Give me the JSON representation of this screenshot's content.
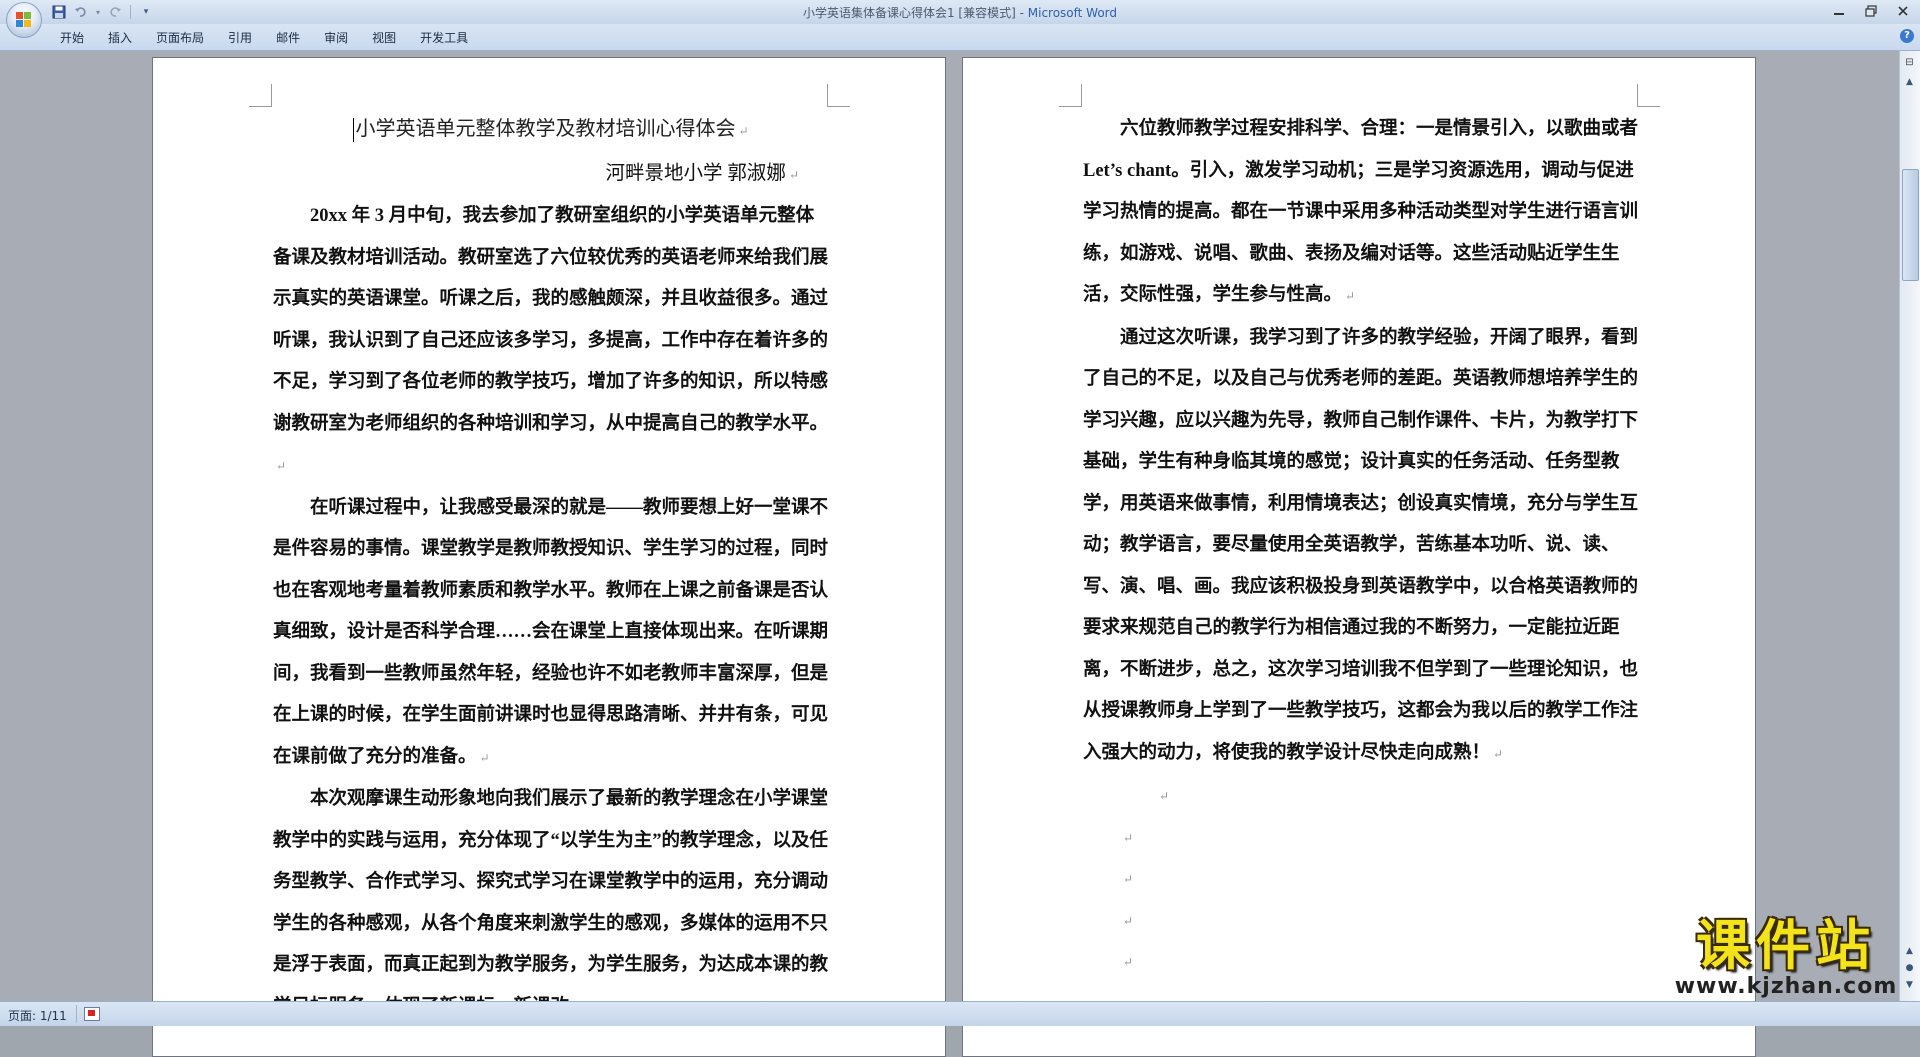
{
  "window": {
    "document_title": "小学英语集体备课心得体会1 [兼容模式] - ",
    "app_name": "Microsoft Word"
  },
  "quick_access": {
    "icons": [
      "save-icon",
      "undo-icon",
      "redo-icon",
      "customize-icon"
    ]
  },
  "ribbon": {
    "tabs": [
      "开始",
      "插入",
      "页面布局",
      "引用",
      "邮件",
      "审阅",
      "视图",
      "开发工具"
    ]
  },
  "document": {
    "title": "小学英语单元整体教学及教材培训心得体会",
    "author_line": "河畔景地小学    郭淑娜",
    "left_paragraphs": [
      "20xx 年 3 月中旬，我去参加了教研室组织的小学英语单元整体备课及教材培训活动。教研室选了六位较优秀的英语老师来给我们展示真实的英语课堂。听课之后，我的感触颇深，并且收益很多。通过听课，我认识到了自己还应该多学习，多提高，工作中存在着许多的不足，学习到了各位老师的教学技巧，增加了许多的知识，所以特感谢教研室为老师组织的各种培训和学习，从中提高自己的教学水平。",
      "在听课过程中，让我感受最深的就是——教师要想上好一堂课不是件容易的事情。课堂教学是教师教授知识、学生学习的过程，同时也在客观地考量着教师素质和教学水平。教师在上课之前备课是否认真细致，设计是否科学合理……会在课堂上直接体现出来。在听课期间，我看到一些教师虽然年轻，经验也许不如老教师丰富深厚，但是在上课的时候，在学生面前讲课时也显得思路清晰、并井有条，可见在课前做了充分的准备。",
      "本次观摩课生动形象地向我们展示了最新的教学理念在小学课堂教学中的实践与运用，充分体现了“以学生为主”的教学理念，以及任务型教学、合作式学习、探究式学习在课堂教学中的运用，充分调动学生的各种感观，从各个角度来刺激学生的感观，多媒体的运用不只是浮于表面，而真正起到为教学服务，为学生服务，为达成本课的教学目标服务，体现了新课标，新课改。"
    ],
    "right_paragraphs": [
      "六位教师教学过程安排科学、合理：一是情景引入，以歌曲或者 Let’s chant。引入，激发学习动机；三是学习资源选用，调动与促进学习热情的提高。都在一节课中采用多种活动类型对学生进行语言训练，如游戏、说唱、歌曲、表扬及编对话等。这些活动贴近学生生活，交际性强，学生参与性高。",
      "通过这次听课，我学习到了许多的教学经验，开阔了眼界，看到了自己的不足，以及自己与优秀老师的差距。英语教师想培养学生的学习兴趣，应以兴趣为先导，教师自己制作课件、卡片，为教学打下基础，学生有种身临其境的感觉；设计真实的任务活动、任务型教学，用英语来做事情，利用情境表达；创设真实情境，充分与学生互动；教学语言，要尽量使用全英语教学，苦练基本功听、说、读、写、演、唱、画。我应该积极投身到英语教学中，以合格英语教师的要求来规范自己的教学行为相信通过我的不断努力，一定能拉近距离，不断进步，总之，这次学习培训我不但学到了一些理论知识，也从授课教师身上学到了一些教学技巧，这都会为我以后的教学工作注入强大的动力，将使我的教学设计尽快走向成熟！"
    ],
    "paragraph_mark": "↵"
  },
  "status_bar": {
    "page_info": "页面: 1/11"
  },
  "watermark": {
    "title": "课件站",
    "url": "www.kjzhan.com"
  }
}
